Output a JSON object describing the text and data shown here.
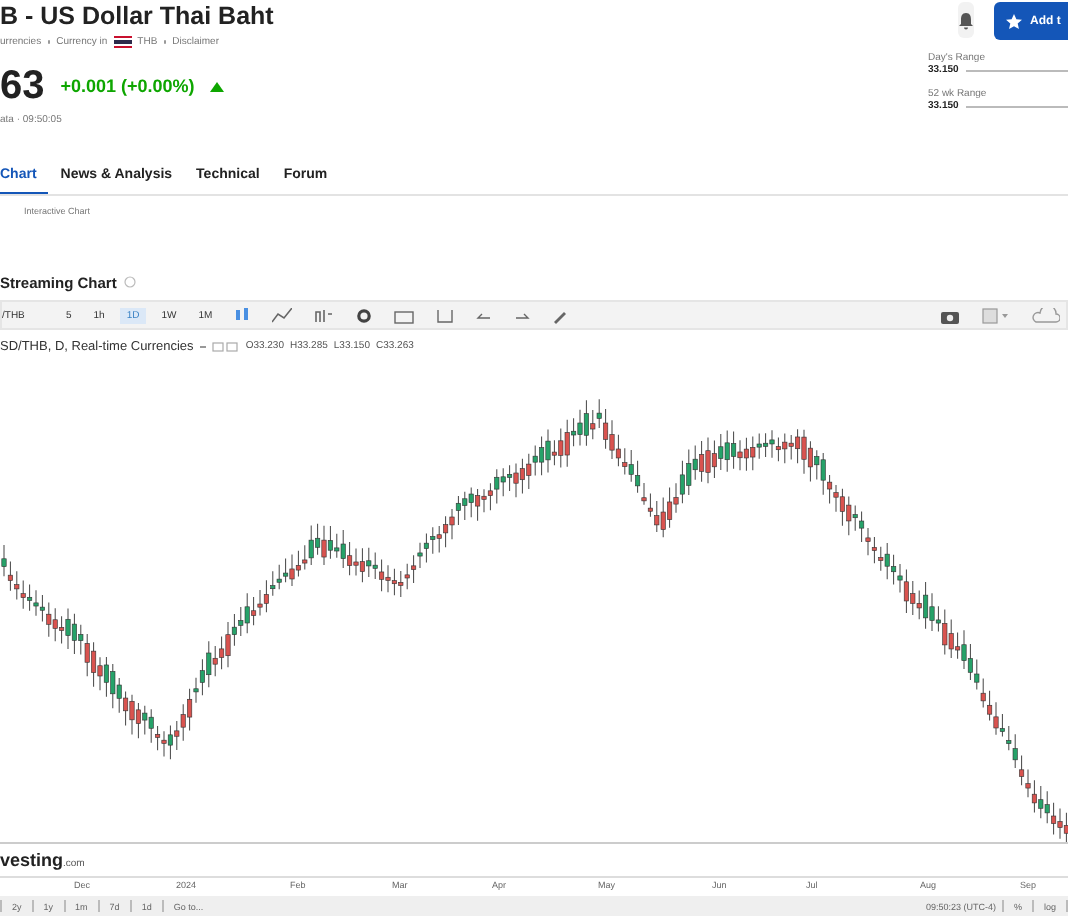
{
  "header": {
    "title": "B - US Dollar Thai Baht",
    "subtitle": {
      "category": "urrencies",
      "currency_label": "Currency in",
      "currency": "THB",
      "disclaimer": "Disclaimer"
    },
    "price": "63",
    "change": "+0.001 (+0.00%)",
    "status": "ata · 09:50:05",
    "rising": true
  },
  "actions": {
    "add_button": "Add t"
  },
  "ranges": [
    {
      "label": "Day's Range",
      "value": "33.150"
    },
    {
      "label": "52 wk Range",
      "value": "33.150"
    }
  ],
  "tabs": [
    {
      "label": "Chart",
      "selected": true
    },
    {
      "label": "News & Analysis",
      "selected": false
    },
    {
      "label": "Technical",
      "selected": false
    },
    {
      "label": "Forum",
      "selected": false
    }
  ],
  "sub_tab": "Interactive Chart",
  "chart": {
    "title": "Streaming Chart",
    "symbol": "/THB",
    "intervals": [
      {
        "label": "5",
        "selected": false
      },
      {
        "label": "1h",
        "selected": false
      },
      {
        "label": "1D",
        "selected": true
      },
      {
        "label": "1W",
        "selected": false
      },
      {
        "label": "1M",
        "selected": false
      }
    ],
    "legend": "SD/THB, D, Real-time Currencies",
    "ohlc": [
      "O33.230",
      "H33.285",
      "L33.150",
      "C33.263"
    ],
    "logo": "vesting",
    "logo_suffix": ".com",
    "x_labels": [
      "Dec",
      "2024",
      "Feb",
      "Mar",
      "Apr",
      "May",
      "Jun",
      "Jul",
      "Aug",
      "Sep"
    ]
  },
  "bottom_bar": {
    "periods": [
      "2y",
      "1y",
      "1m",
      "7d",
      "1d"
    ],
    "goto": "Go to...",
    "time": "09:50:23 (UTC-4)",
    "percent": "%",
    "log": "log"
  }
}
